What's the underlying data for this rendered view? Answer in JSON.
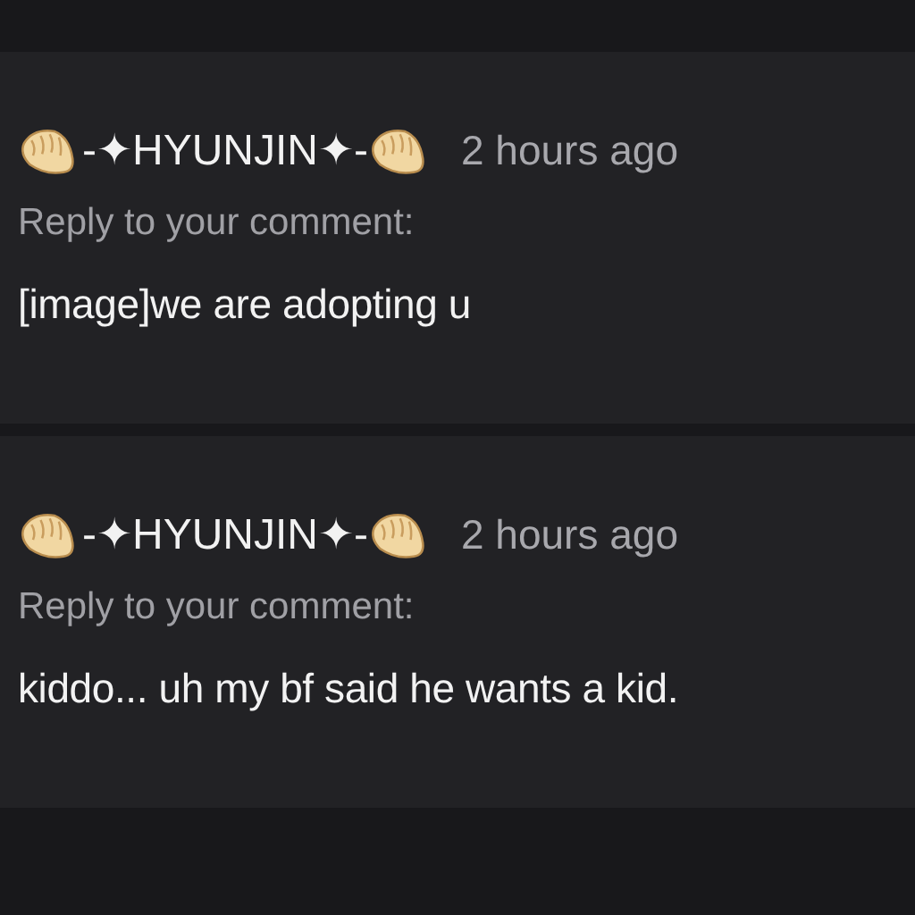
{
  "notifications": [
    {
      "user": "-✦HYUNJIN✦-",
      "time": "2 hours ago",
      "action": "Reply to your comment:",
      "message": "[image]we are adopting u"
    },
    {
      "user": "-✦HYUNJIN✦-",
      "time": "2 hours ago",
      "action": "Reply to your comment:",
      "message": "kiddo... uh my bf said he wants a kid."
    }
  ]
}
